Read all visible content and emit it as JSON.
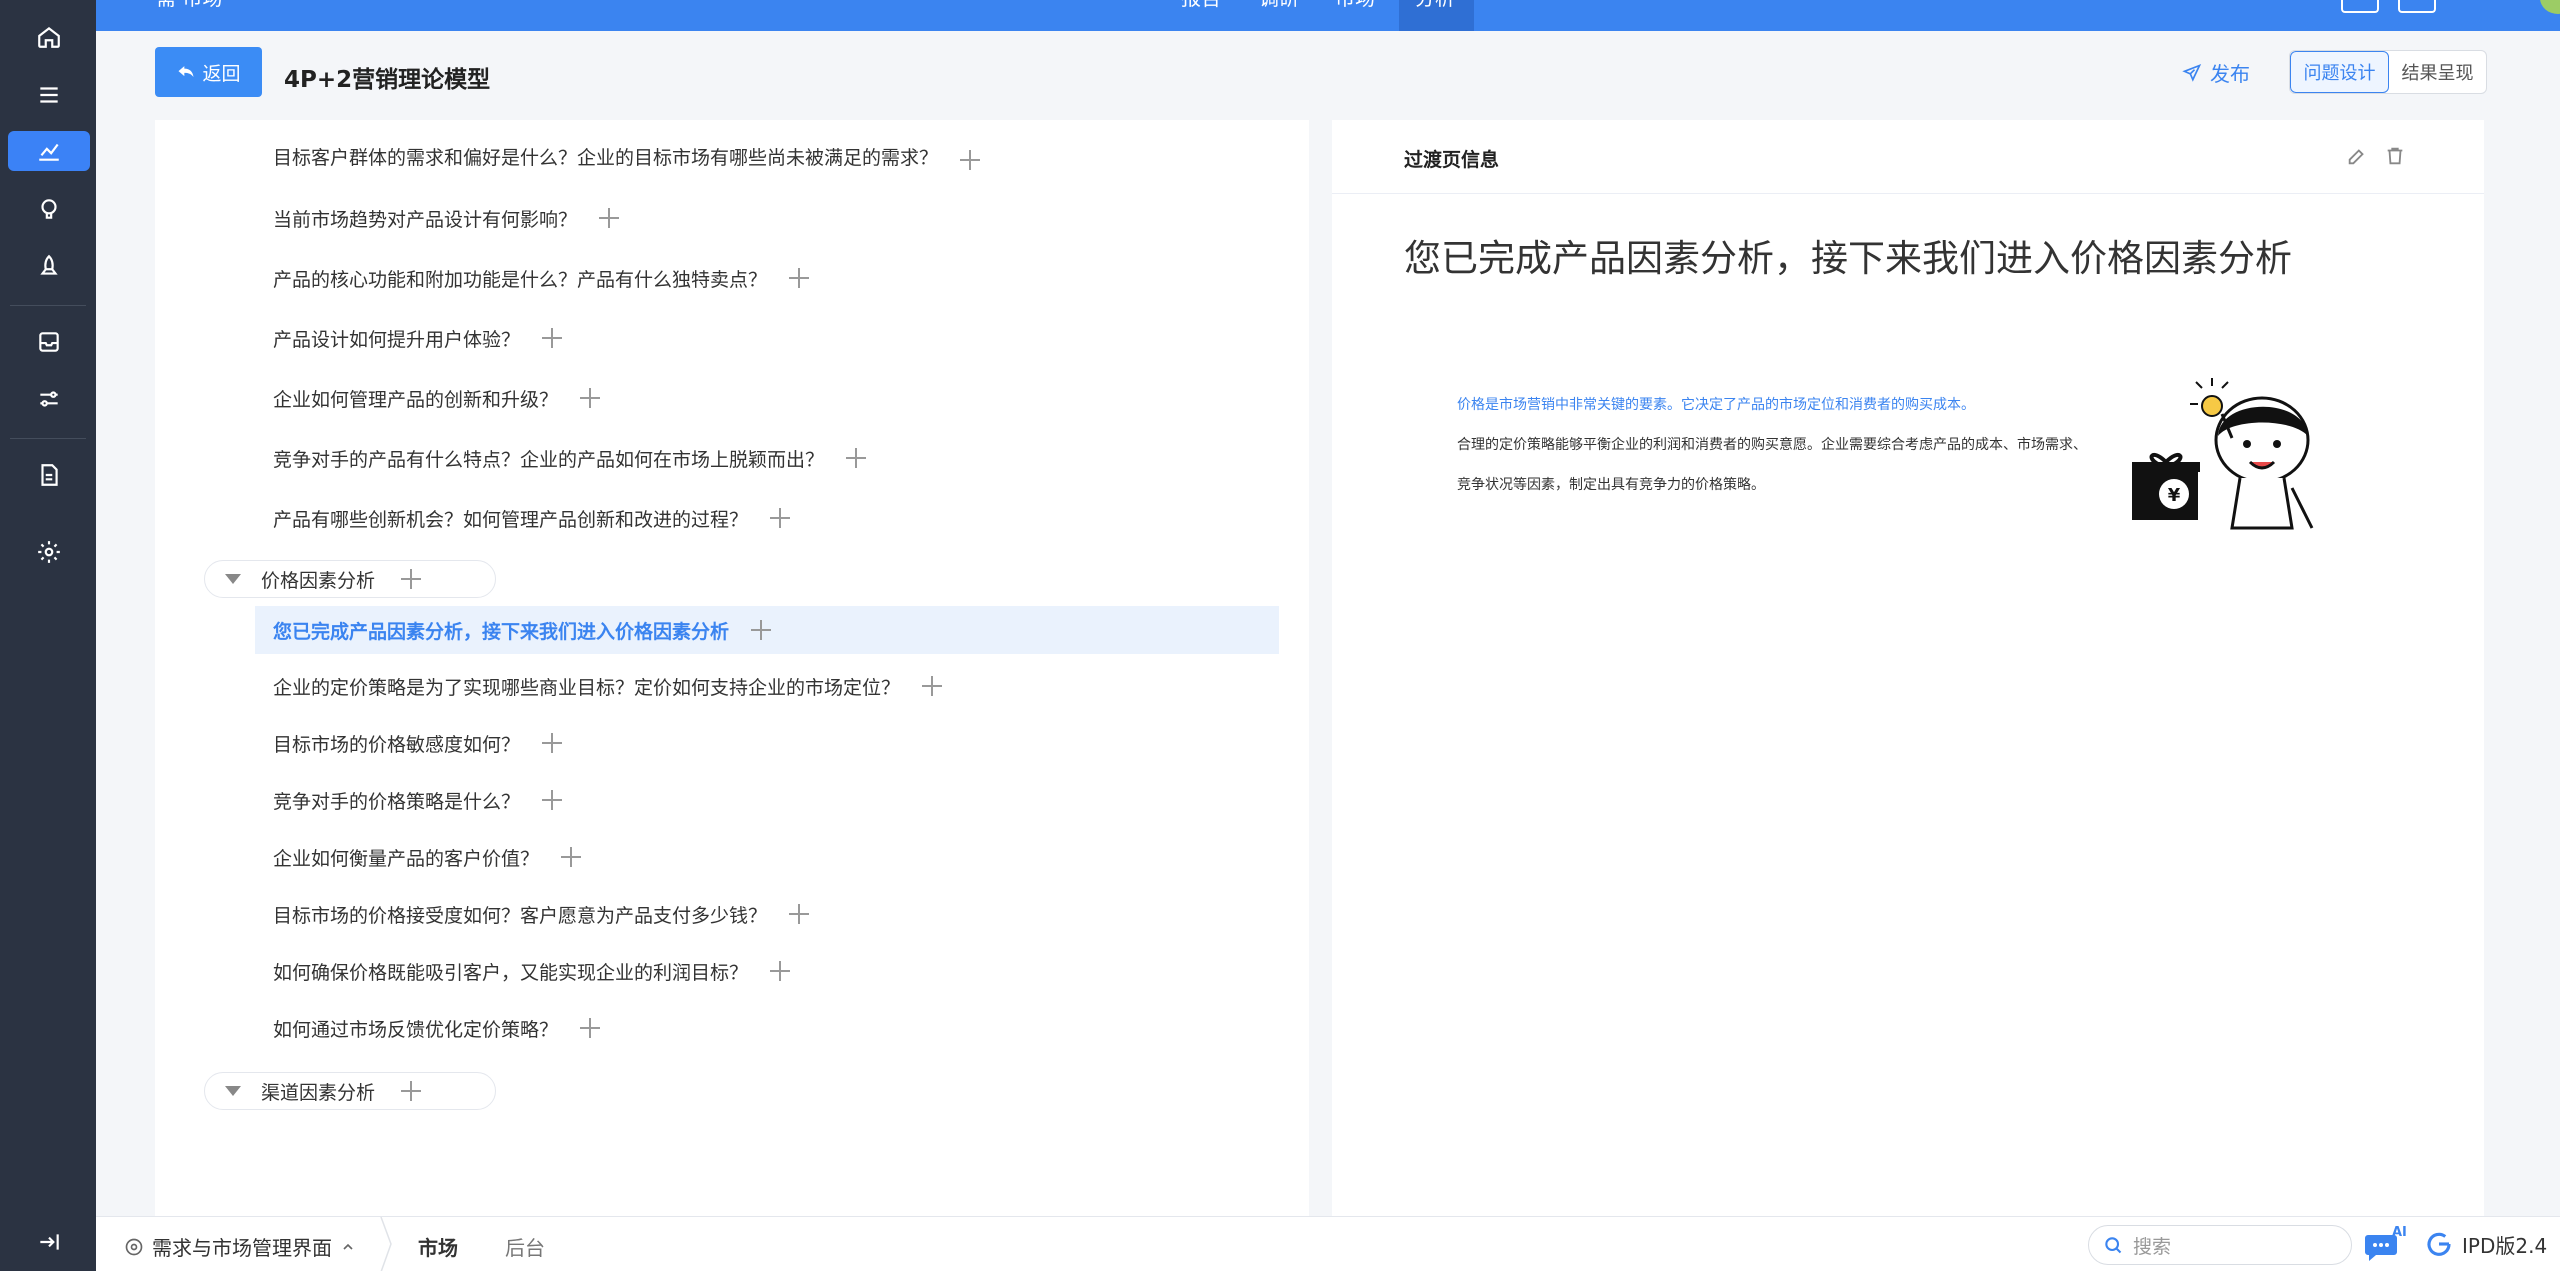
{
  "topbar": {
    "nav": [
      {
        "label": "报告"
      },
      {
        "label": "调研"
      },
      {
        "label": "市场"
      },
      {
        "label": "分析"
      }
    ],
    "breadcrumb_fragment": "需 市场"
  },
  "header": {
    "back_label": "返回",
    "title": "4P+2营销理论模型",
    "publish_label": "发布",
    "tabs": [
      {
        "label": "问题设计",
        "active": true
      },
      {
        "label": "结果呈现",
        "active": false
      }
    ]
  },
  "tree": {
    "product_items": [
      "目标客户群体的需求和偏好是什么？企业的目标市场有哪些尚未被满足的需求？",
      "当前市场趋势对产品设计有何影响？",
      "产品的核心功能和附加功能是什么？产品有什么独特卖点？",
      "产品设计如何提升用户体验？",
      "企业如何管理产品的创新和升级？",
      "竞争对手的产品有什么特点？企业的产品如何在市场上脱颖而出？",
      "产品有哪些创新机会？如何管理产品创新和改进的过程？"
    ],
    "price_group": "价格因素分析",
    "price_items": [
      "您已完成产品因素分析，接下来我们进入价格因素分析",
      "企业的定价策略是为了实现哪些商业目标？定价如何支持企业的市场定位？",
      "目标市场的价格敏感度如何？",
      "竞争对手的价格策略是什么？",
      "企业如何衡量产品的客户价值？",
      "目标市场的价格接受度如何？客户愿意为产品支付多少钱？",
      "如何确保价格既能吸引客户，又能实现企业的利润目标？",
      "如何通过市场反馈优化定价策略？"
    ],
    "channel_group": "渠道因素分析"
  },
  "detail": {
    "panel_title": "过渡页信息",
    "headline": "您已完成产品因素分析，接下来我们进入价格因素分析",
    "line1": "价格是市场营销中非常关键的要素。它决定了产品的市场定位和消费者的购买成本。",
    "line2": "合理的定价策略能够平衡企业的利润和消费者的购买意愿。企业需要综合考虑产品的成本、市场需求、",
    "line3": "竞争状况等因素，制定出具有竞争力的价格策略。",
    "illustration_mark": "¥"
  },
  "bottombar": {
    "workspace_label": "需求与市场管理界面",
    "tabs": [
      {
        "label": "市场",
        "active": true
      },
      {
        "label": "后台",
        "active": false
      }
    ],
    "search_placeholder": "搜索",
    "ai_badge": "AI",
    "version": "IPD版2.4"
  },
  "colors": {
    "accent": "#3b84f0",
    "sidebar_bg": "#2b3342",
    "selected_row_bg": "#eaf2fd"
  }
}
